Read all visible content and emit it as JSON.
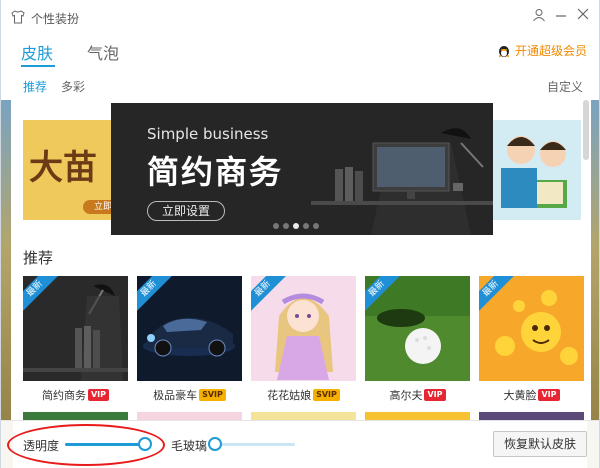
{
  "window": {
    "title": "个性装扮",
    "user_icon": "user-icon",
    "minimize_icon": "minimize-icon",
    "close_icon": "close-icon"
  },
  "tabs": [
    {
      "label": "皮肤",
      "active": true
    },
    {
      "label": "气泡",
      "active": false
    }
  ],
  "vip_link": {
    "label": "开通超级会员",
    "icon": "qq-penguin-icon"
  },
  "subtabs": [
    {
      "label": "推荐",
      "active": true
    },
    {
      "label": "多彩",
      "active": false
    }
  ],
  "customize_label": "自定义",
  "banner": {
    "left_text": "大苗",
    "left_button": "立即",
    "english": "Simple business",
    "chinese": "简约商务",
    "button": "立即设置",
    "slides": 5,
    "active_slide": 2
  },
  "section_title": "推荐",
  "cards": [
    {
      "name": "简约商务",
      "ribbon": "最新",
      "badge": "VIP",
      "badge_type": "vip"
    },
    {
      "name": "极品豪车",
      "ribbon": "最新",
      "badge": "SVIP",
      "badge_type": "svip"
    },
    {
      "name": "花花姑娘",
      "ribbon": "最新",
      "badge": "SVIP",
      "badge_type": "svip"
    },
    {
      "name": "高尔夫",
      "ribbon": "最新",
      "badge": "VIP",
      "badge_type": "vip"
    },
    {
      "name": "大黄脸",
      "ribbon": "最新",
      "badge": "VIP",
      "badge_type": "vip"
    }
  ],
  "footer": {
    "opacity_label": "透明度",
    "opacity_level": 0.95,
    "blur_label": "毛玻璃",
    "blur_level": 0.0,
    "restore_label": "恢复默认皮肤"
  },
  "colors": {
    "accent": "#1e9bd6",
    "vip": "#e62733",
    "svip": "#f5b000",
    "vip_link": "#f08a00",
    "annotation": "#e81a1a"
  }
}
